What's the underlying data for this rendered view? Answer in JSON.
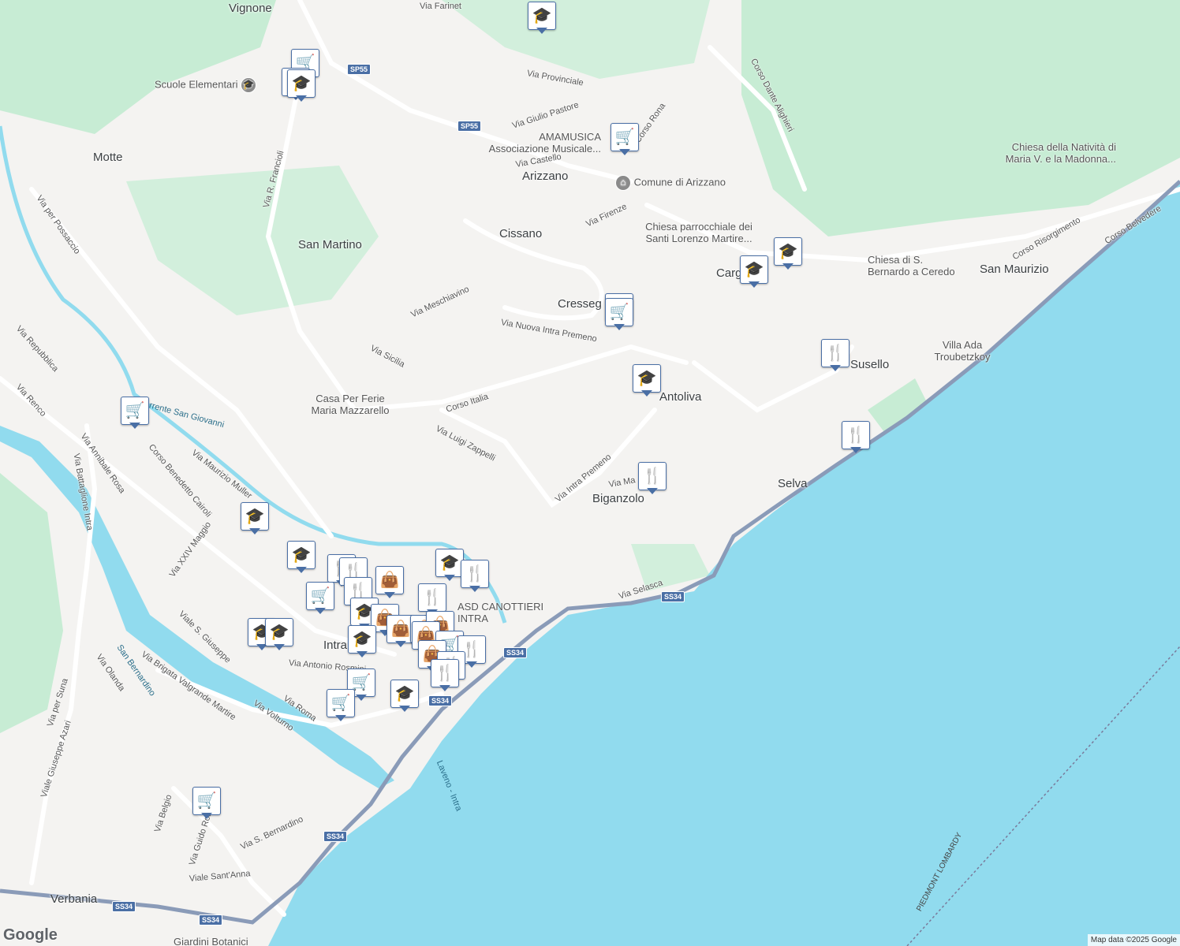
{
  "towns": [
    "Vignone",
    "Motte",
    "San Martino",
    "Arizzano",
    "Cissano",
    "Cresseg",
    "Antoliva",
    "Biganzolo",
    "Selva",
    "Susello",
    "San Maurizio",
    "Carg",
    "Intra",
    "Verbania"
  ],
  "streets": [
    "Via Farinet",
    "Via Provinciale",
    "Via Giulio Pastore",
    "Corso Rona",
    "Via Castello",
    "Corso Dante Alighieri",
    "Via R. Francioli",
    "Via per Possaccio",
    "Via Meschiavino",
    "Via Nuova Intra Premeno",
    "Via Sicilia",
    "Corso Italia",
    "Via Luigi Zappelli",
    "Via Repubblica",
    "Via Renco",
    "Via Annibale Rosa",
    "Corso Benedetto Cairoli",
    "Via Maurizio Muller",
    "Via Battaglione Intra",
    "Via XXIV Maggio",
    "Viale S. Giuseppe",
    "Via Intra Premeno",
    "Via Selasca",
    "Corso Risorgimento",
    "Corso Belvedere",
    "Via Firenze",
    "Via Brigata Valgrande Martire",
    "Via Olanda",
    "Via Antonio Rosmini",
    "Via Roma",
    "Via Volturno",
    "Via per Suna",
    "Viale Giuseppe Azari",
    "Via Belgio",
    "Via Guido Rossi",
    "Via S. Bernardino",
    "Viale Sant'Anna",
    "Via Ma"
  ],
  "pois": [
    "Scuole Elementari",
    "AMAMUSICA Associazione Musicale...",
    "Comune di Arizzano",
    "Chiesa parrocchiale dei Santi Lorenzo Martire...",
    "Chiesa di S. Bernardo a Ceredo",
    "Chiesa della Natività di Maria V. e la Madonna...",
    "Casa Per Ferie Maria Mazzarello",
    "Villa Ada Troubetzkoy",
    "ASD CANOTTIERI INTRA",
    "Giardini Botanici"
  ],
  "water": [
    "Torrente San Giovanni",
    "San Bernardino",
    "Laveno - Intra"
  ],
  "shields": [
    "SP55",
    "SS34"
  ],
  "border": "PIEDMONT LOMBARDY",
  "attribution": "Map data ©2025 Google",
  "logo": "Google",
  "colors": {
    "water": "#91dbee",
    "park": "#c7ecd4",
    "land": "#f4f3f1",
    "highway": "#8a9bb8",
    "marker": "#4a6fa5"
  },
  "marker_types": {
    "shop": "shopping-cart",
    "school": "graduation-cap",
    "food": "fork-knife",
    "bag": "shopping-bag"
  }
}
